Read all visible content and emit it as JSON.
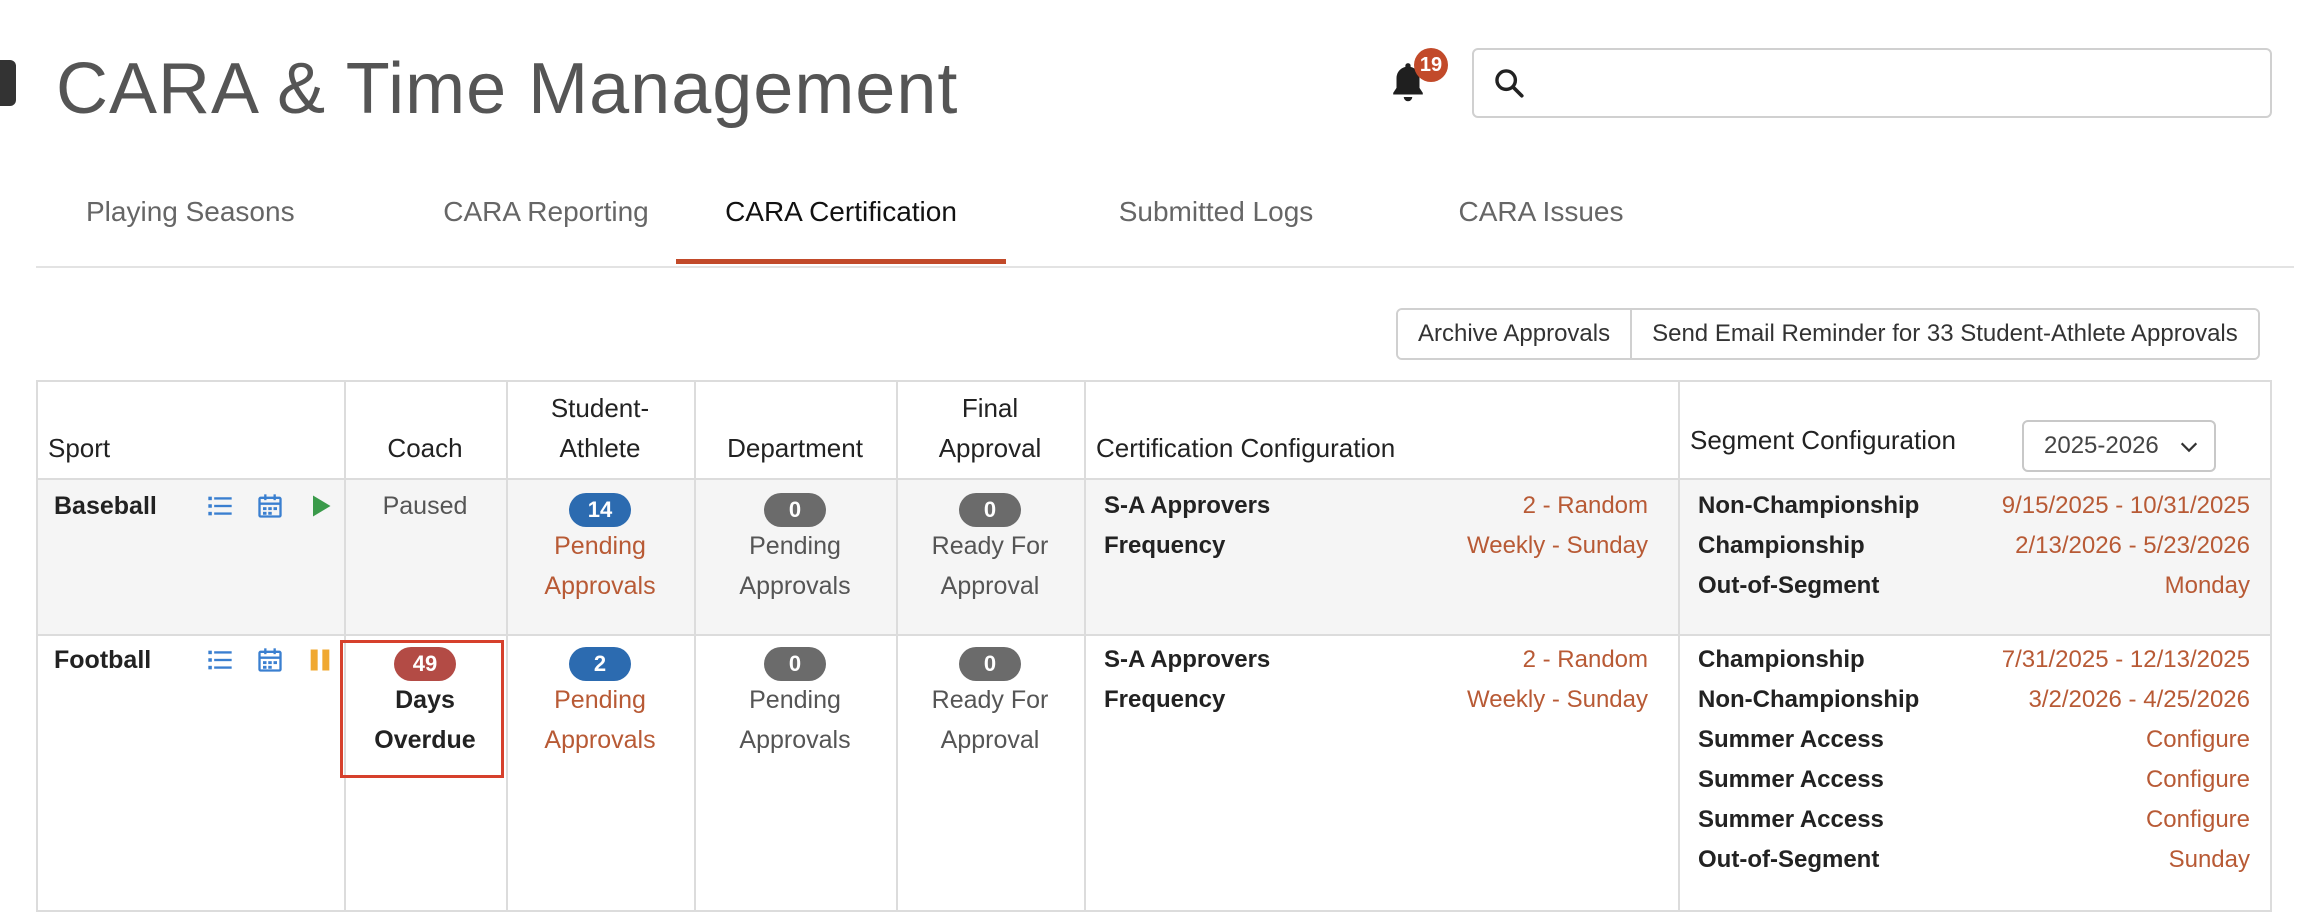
{
  "header": {
    "title": "CARA & Time Management",
    "notification_count": "19",
    "search": {
      "value": "",
      "placeholder": ""
    }
  },
  "tabs": [
    {
      "label": "Playing Seasons",
      "active": false
    },
    {
      "label": "CARA Reporting",
      "active": false
    },
    {
      "label": "CARA Certification",
      "active": true
    },
    {
      "label": "Submitted Logs",
      "active": false
    },
    {
      "label": "CARA Issues",
      "active": false
    }
  ],
  "actions": {
    "archive": "Archive Approvals",
    "send_reminder": "Send Email Reminder for 33 Student-Athlete Approvals"
  },
  "table": {
    "headers": {
      "sport": "Sport",
      "coach": "Coach",
      "student_athlete_1": "Student-",
      "student_athlete_2": "Athlete",
      "department": "Department",
      "final_approval_1": "Final",
      "final_approval_2": "Approval",
      "certification_configuration": "Certification Configuration",
      "segment_configuration": "Segment Configuration"
    },
    "year_select": "2025-2026",
    "rows": [
      {
        "sport": "Baseball",
        "state_icon": "play-icon",
        "coach": {
          "status": "Paused"
        },
        "student_athlete": {
          "count": "14",
          "line1": "Pending",
          "line2": "Approvals"
        },
        "department": {
          "count": "0",
          "line1": "Pending",
          "line2": "Approvals"
        },
        "final_approval": {
          "count": "0",
          "line1": "Ready For",
          "line2": "Approval"
        },
        "certification": [
          {
            "label": "S-A Approvers",
            "value": "2 - Random"
          },
          {
            "label": "Frequency",
            "value": "Weekly - Sunday"
          }
        ],
        "segments": [
          {
            "label": "Non-Championship",
            "value": "9/15/2025 - 10/31/2025"
          },
          {
            "label": "Championship",
            "value": "2/13/2026 - 5/23/2026"
          },
          {
            "label": "Out-of-Segment",
            "value": "Monday"
          }
        ]
      },
      {
        "sport": "Football",
        "state_icon": "pause-icon",
        "coach": {
          "count": "49",
          "line1": "Days",
          "line2": "Overdue"
        },
        "student_athlete": {
          "count": "2",
          "line1": "Pending",
          "line2": "Approvals"
        },
        "department": {
          "count": "0",
          "line1": "Pending",
          "line2": "Approvals"
        },
        "final_approval": {
          "count": "0",
          "line1": "Ready For",
          "line2": "Approval"
        },
        "certification": [
          {
            "label": "S-A Approvers",
            "value": "2 - Random"
          },
          {
            "label": "Frequency",
            "value": "Weekly - Sunday"
          }
        ],
        "segments": [
          {
            "label": "Championship",
            "value": "7/31/2025 - 12/13/2025"
          },
          {
            "label": "Non-Championship",
            "value": "3/2/2026 - 4/25/2026"
          },
          {
            "label": "Summer Access",
            "value": "Configure"
          },
          {
            "label": "Summer Access",
            "value": "Configure"
          },
          {
            "label": "Summer Access",
            "value": "Configure"
          },
          {
            "label": "Out-of-Segment",
            "value": "Sunday"
          }
        ]
      }
    ]
  },
  "colors": {
    "accent": "#c24a2a",
    "value_text": "#b85a35",
    "pill_blue": "#2c6bb0",
    "pill_grey": "#6b6b6b",
    "pill_red": "#b34b45",
    "play_icon": "#3a9a4a",
    "pause_icon": "#f0a830",
    "list_icon": "#3a7fd0"
  }
}
